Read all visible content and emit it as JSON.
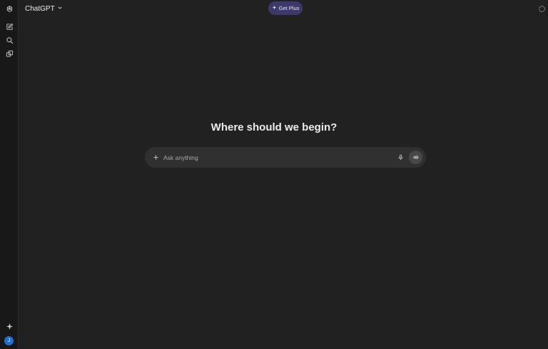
{
  "header": {
    "model_name": "ChatGPT",
    "upgrade_label": "Get Plus"
  },
  "sidebar": {
    "icons": [
      "openai-logo-icon",
      "new-chat-icon",
      "search-icon",
      "library-icon",
      "sparkle-icon"
    ],
    "user_initial": "J"
  },
  "main": {
    "headline": "Where should we begin?",
    "composer": {
      "placeholder": "Ask anything",
      "value": ""
    }
  },
  "colors": {
    "background": "#212121",
    "sidebar": "#181818",
    "composer": "#303030",
    "upgrade_button": "#3c3a6b",
    "avatar": "#1f6fd1"
  }
}
